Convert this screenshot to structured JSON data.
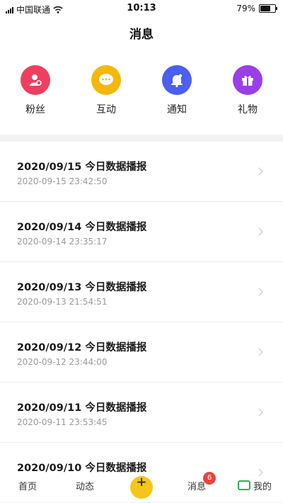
{
  "status": {
    "carrier": "中国联通",
    "time": "10:13",
    "battery_label": "79%",
    "battery_level": 0.79
  },
  "header": {
    "title": "消息"
  },
  "categories": [
    {
      "label": "粉丝",
      "icon": "fans-icon",
      "color": "#ef3f5f"
    },
    {
      "label": "互动",
      "icon": "chat-bubble-icon",
      "color": "#f5b80a"
    },
    {
      "label": "通知",
      "icon": "bell-icon",
      "color": "#4b5ff0"
    },
    {
      "label": "礼物",
      "icon": "gift-icon",
      "color": "#9a3ee6"
    }
  ],
  "messages": [
    {
      "title": "2020/09/15 今日数据播报",
      "time": "2020-09-15 23:42:50"
    },
    {
      "title": "2020/09/14 今日数据播报",
      "time": "2020-09-14 23:35:17"
    },
    {
      "title": "2020/09/13 今日数据播报",
      "time": "2020-09-13 21:54:51"
    },
    {
      "title": "2020/09/12 今日数据播报",
      "time": "2020-09-12 23:44:00"
    },
    {
      "title": "2020/09/11 今日数据播报",
      "time": "2020-09-11 23:53:45"
    },
    {
      "title": "2020/09/10 今日数据播报",
      "time": ""
    }
  ],
  "tabbar": {
    "tabs": [
      {
        "label": "首页"
      },
      {
        "label": "动态"
      },
      {
        "label": "消息"
      },
      {
        "label": "我的"
      }
    ],
    "plus_label": "+",
    "message_badge": "6"
  }
}
